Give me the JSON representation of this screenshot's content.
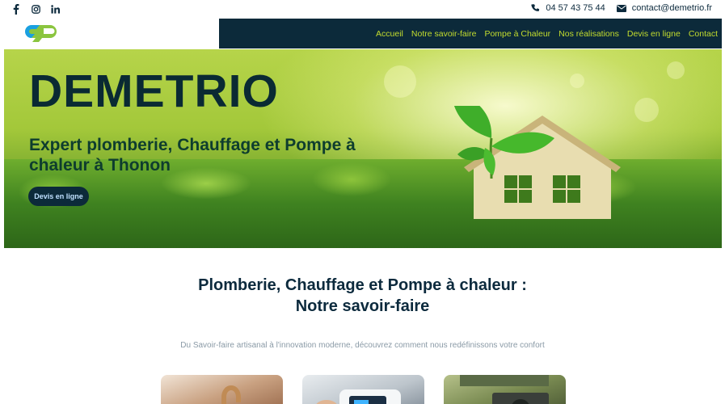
{
  "topbar": {
    "social": [
      {
        "icon": "facebook-icon"
      },
      {
        "icon": "instagram-icon"
      },
      {
        "icon": "linkedin-icon"
      }
    ],
    "phone": "04 57 43 75 44",
    "email": "contact@demetrio.fr"
  },
  "nav": {
    "items": [
      "Accueil",
      "Notre savoir-faire",
      "Pompe à Chaleur",
      "Nos réalisations",
      "Devis en ligne",
      "Contact"
    ]
  },
  "hero": {
    "title": "DEMETRIO",
    "subtitle": "Expert plomberie, Chauffage et Pompe à chaleur à Thonon",
    "cta": "Devis en ligne"
  },
  "section": {
    "title_line1": "Plomberie, Chauffage et Pompe à chaleur :",
    "title_line2": "Notre savoir-faire",
    "intro": "Du Savoir-faire artisanal à l'innovation moderne, découvrez comment nous redéfinissons votre confort"
  },
  "colors": {
    "navy": "#0c2a3a",
    "accent_green": "#c3dc2e",
    "logo_blue": "#1aa0e0"
  }
}
